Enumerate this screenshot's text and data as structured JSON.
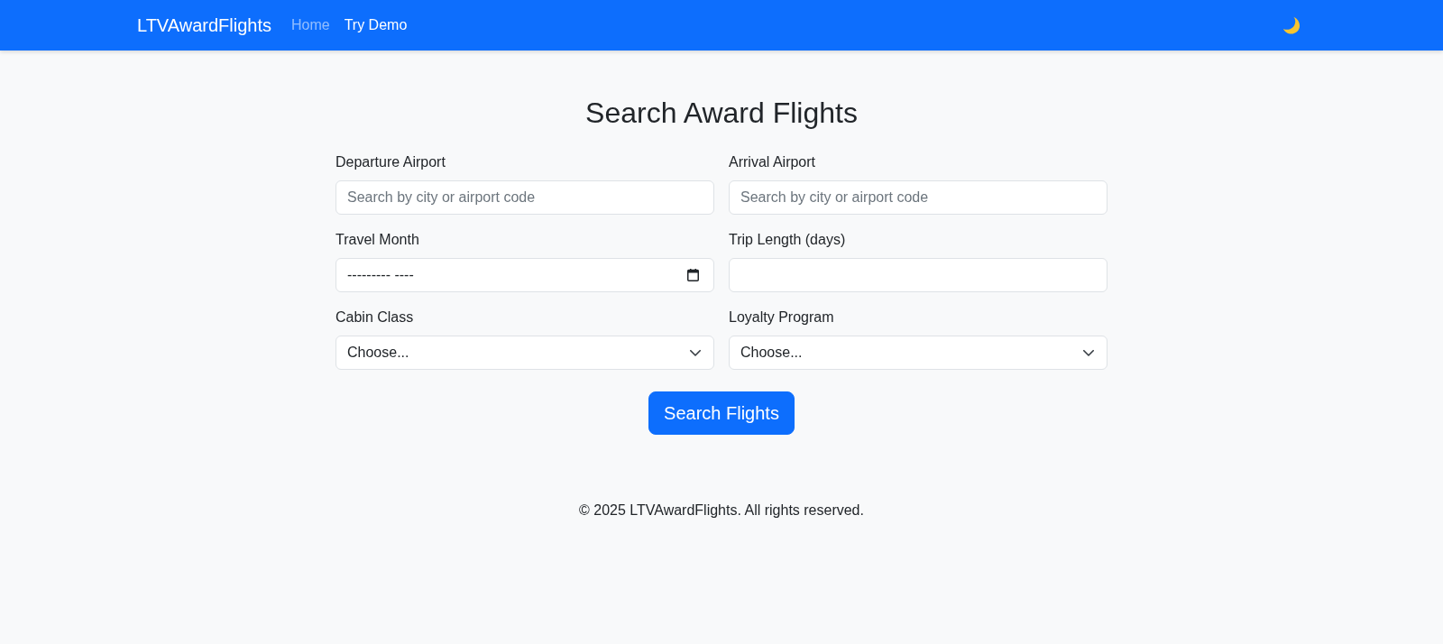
{
  "navbar": {
    "brand": "LTVAwardFlights",
    "links": [
      {
        "label": "Home",
        "selected": false
      },
      {
        "label": "Try Demo",
        "selected": true
      }
    ]
  },
  "page": {
    "title": "Search Award Flights"
  },
  "form": {
    "fields": [
      {
        "label": "Departure Airport",
        "kind": "text",
        "placeholder": "Search by city or airport code"
      },
      {
        "label": "Arrival Airport",
        "kind": "text",
        "placeholder": "Search by city or airport code"
      },
      {
        "label": "Travel Month",
        "kind": "month",
        "placeholder": "--------- ----"
      },
      {
        "label": "Trip Length (days)",
        "kind": "number"
      },
      {
        "label": "Cabin Class",
        "kind": "select",
        "value": "Choose..."
      },
      {
        "label": "Loyalty Program",
        "kind": "select",
        "value": "Choose..."
      }
    ],
    "submit": "Search Flights"
  },
  "footer": {
    "text": "© 2025 LTVAwardFlights. All rights reserved."
  }
}
